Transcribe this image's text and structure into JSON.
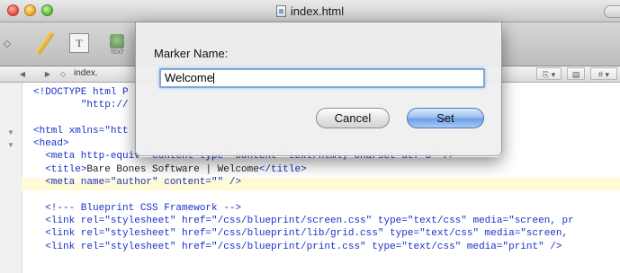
{
  "window": {
    "title": "index.html"
  },
  "toolbar": {
    "items": [
      "pencil-tool",
      "text-tool",
      "text-clipping"
    ],
    "text_clipping_label": "TEXT",
    "tt_label": "T",
    "left_symbol": "◇"
  },
  "navbar": {
    "file_label": "index.",
    "back": "◀",
    "forward": "▶",
    "doc_symbol": "◇",
    "right_buttons": [
      "⎘ ▾",
      "▤",
      "# ▾"
    ]
  },
  "editor": {
    "lines": [
      [
        [
          "tag",
          "<!DOCTYPE html P"
        ]
      ],
      [
        [
          "plain",
          "        "
        ],
        [
          "str",
          "\"http://"
        ]
      ],
      [
        [
          "plain",
          ""
        ]
      ],
      [
        [
          "tag",
          "<html xmlns=\"htt"
        ]
      ],
      [
        [
          "tag",
          "<head>"
        ]
      ],
      [
        [
          "plain",
          "  "
        ],
        [
          "tag",
          "<meta http-equiv=\"content-type\" content=\"text/html; charset=utf-8\" />"
        ]
      ],
      [
        [
          "plain",
          "  "
        ],
        [
          "tag",
          "<title>"
        ],
        [
          "plain",
          "Bare Bones Software | Welcome"
        ],
        [
          "tag",
          "</title>"
        ]
      ],
      [
        [
          "plain",
          "  "
        ],
        [
          "tag",
          "<meta name=\"author\" content=\"\" />"
        ]
      ],
      [
        [
          "plain",
          ""
        ]
      ],
      [
        [
          "plain",
          "  "
        ],
        [
          "tag",
          "<!--- Blueprint CSS Framework -->"
        ]
      ],
      [
        [
          "plain",
          "  "
        ],
        [
          "tag",
          "<link rel=\"stylesheet\" href=\"/css/blueprint/screen.css\" type=\"text/css\" media=\"screen, pr"
        ]
      ],
      [
        [
          "plain",
          "  "
        ],
        [
          "tag",
          "<link rel=\"stylesheet\" href=\"/css/blueprint/lib/grid.css\" type=\"text/css\" media=\"screen,"
        ]
      ],
      [
        [
          "plain",
          "  "
        ],
        [
          "tag",
          "<link rel=\"stylesheet\" href=\"/css/blueprint/print.css\" type=\"text/css\" media=\"print\" />"
        ]
      ]
    ]
  },
  "dialog": {
    "label": "Marker Name:",
    "input_value": "Welcome",
    "cancel_label": "Cancel",
    "set_label": "Set"
  }
}
